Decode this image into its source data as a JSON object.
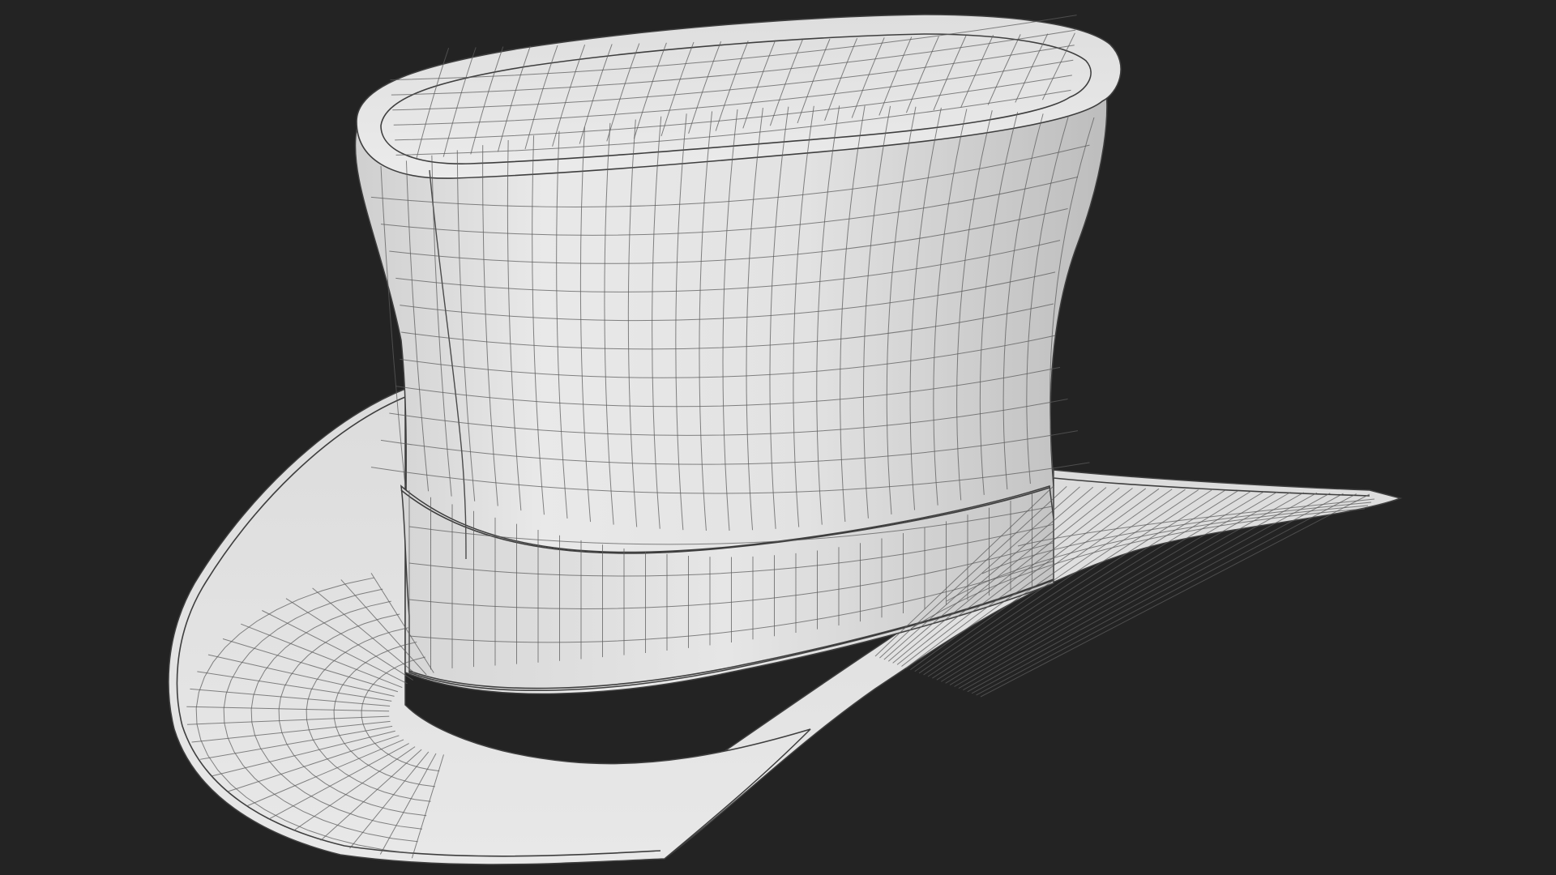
{
  "scene": {
    "subject": "top-hat-wireframe-render",
    "background_color": "#232323",
    "surface_color": "#e6e6e6",
    "wire_color": "#5c5c5c"
  }
}
